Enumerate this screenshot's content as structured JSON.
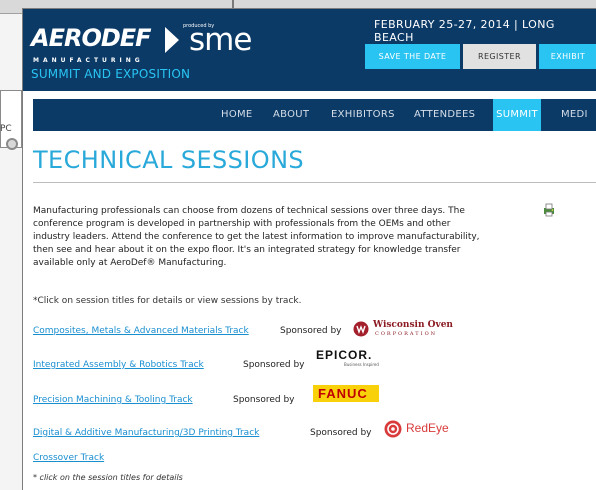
{
  "header": {
    "logo": {
      "main": "AERODEF",
      "sub": "MANUFACTURING",
      "produced_by": "produced by",
      "sme": "sme"
    },
    "summit": "SUMMIT AND EXPOSITION",
    "date": "FEBRUARY 25-27, 2014 | LONG BEACH",
    "buttons": {
      "save_the_date": "SAVE THE DATE",
      "register": "REGISTER",
      "exhibit": "EXHIBIT"
    }
  },
  "nav": {
    "items": [
      "HOME",
      "ABOUT",
      "EXHIBITORS",
      "ATTENDEES",
      "SUMMIT",
      "MEDI"
    ],
    "active": "SUMMIT"
  },
  "title": "TECHNICAL SESSIONS",
  "intro": [
    "Manufacturing professionals can choose from dozens of technical sessions over three days. The",
    "conference program is developed in partnership with professionals from the OEMs and other",
    "industry leaders. Attend the conference to get the latest information to improve manufacturability,",
    "then see and hear about it on the expo floor.  It's an integrated strategy for knowledge transfer",
    "available only at AeroDef® Manufacturing."
  ],
  "click_note": "*Click on session titles for details or view sessions by track.",
  "tracks": [
    {
      "title": "Composites, Metals & Advanced Materials Track",
      "sponsor_label": "Sponsored by",
      "sponsor_logo": "Wisconsin Oven",
      "sponsor_logo_sub": "CORPORATION"
    },
    {
      "title": "Integrated Assembly & Robotics Track",
      "sponsor_label": "Sponsored by",
      "sponsor_logo": "EPICOR.",
      "sponsor_logo_sub": "Business Inspired"
    },
    {
      "title": "Precision Machining & Tooling Track",
      "sponsor_label": "Sponsored by",
      "sponsor_logo": "FANUC",
      "sponsor_logo_sub": ""
    },
    {
      "title": "Digital & Additive Manufacturing/3D Printing Track",
      "sponsor_label": "Sponsored by",
      "sponsor_logo": "RedEye",
      "sponsor_logo_sub": ""
    },
    {
      "title": "Crossover Track",
      "sponsor_label": "",
      "sponsor_logo": "",
      "sponsor_logo_sub": ""
    }
  ],
  "footer_note": "* click on the session titles for details",
  "background_window": {
    "text": "PC"
  },
  "colors": {
    "header_bg": "#0b3a67",
    "accent_cyan": "#29c4f2",
    "title_blue": "#29a9d9",
    "link_blue": "#1a8fd0",
    "fanuc_yellow": "#f8d10b",
    "wisconsin_red": "#a31f2b",
    "redeye_red": "#d93b3b"
  },
  "icons": {
    "print": "print-icon",
    "wisconsin_logo": "wisconsin-oven-logo",
    "redeye_logo": "redeye-logo"
  }
}
